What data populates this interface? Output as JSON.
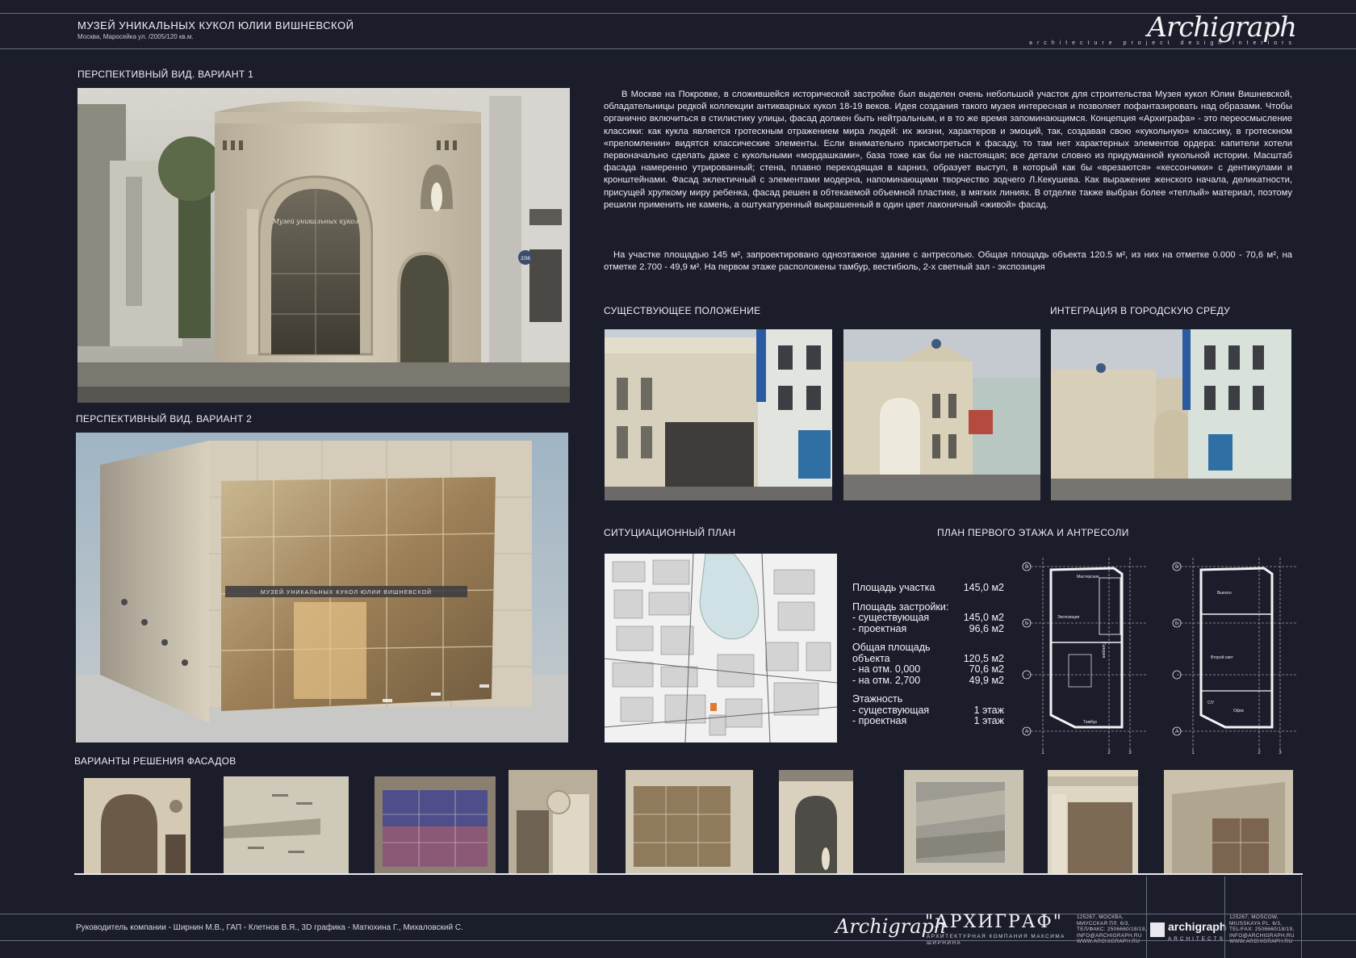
{
  "header": {
    "title": "МУЗЕЙ УНИКАЛЬНЫХ КУКОЛ ЮЛИИ ВИШНЕВСКОЙ",
    "subtitle": "Москва, Маросейка ул. /2005/120 кв.м.",
    "logo_script": "Archigraph",
    "logo_tagline": "architecture project design interiors"
  },
  "sections": {
    "perspective_1": "ПЕРСПЕКТИВНЫЙ ВИД. ВАРИАНТ 1",
    "perspective_2": "ПЕРСПЕКТИВНЫЙ ВИД. ВАРИАНТ 2",
    "existing": "СУЩЕСТВУЮЩЕЕ ПОЛОЖЕНИЕ",
    "integration": "ИНТЕГРАЦИЯ В ГОРОДСКУЮ СРЕДУ",
    "site_plan": "СИТУЦИАЦИОННЫЙ ПЛАН",
    "floor_plan": "ПЛАН ПЕРВОГО ЭТАЖА И АНТРЕСОЛИ",
    "facades": "ВАРИАНТЫ РЕШЕНИЯ ФАСАДОВ"
  },
  "description": {
    "paragraph_1": "В Москве на Покровке, в сложившейся исторической застройке был выделен очень небольшой участок для строительства Музея кукол Юлии Вишневской, обладательницы редкой коллекции антикварных кукол 18-19 веков. Идея создания такого музея интересная и позволяет пофантазировать над образами. Чтобы органично включиться в стилистику улицы, фасад должен быть нейтральным, и в то же время запоминающимся. Концепция «Архиграфа» - это переосмысление классики: как кукла является гротескным отражением мира людей: их жизни, характеров и эмоций, так, создавая свою «кукольную» классику, в гротескном «преломлении» видятся классические элементы. Если внимательно присмотреться к фасаду, то там нет характерных элементов ордера: капители хотели первоначально сделать даже с кукольными «мордашками», база тоже как бы не настоящая; все детали словно из придуманной кукольной истории. Масштаб фасада намеренно утрированный; стена, плавно переходящая в карниз, образует выступ, в который как бы «врезаются» «кессончики» с дентикулами и кронштейнами. Фасад эклектичный с элементами модерна, напоминающими творчество зодчего Л.Кекушева. Как выражение женского начала, деликатности, присущей хрупкому миру ребенка, фасад решен в обтекаемой объемной пластике, в мягких линиях. В отделке также выбран более «теплый» материал, поэтому решили применить не камень, а оштукатуренный выкрашенный в один цвет лаконичный «живой» фасад.",
    "paragraph_2": "На участке площадью 145 м², запроектировано одноэтажное здание с антресолью. Общая площадь объекта 120.5 м², из них на отметке 0.000 - 70,6 м², на отметке 2.700 - 49,9 м². На первом этаже расположены тамбур, вестибюль, 2-х светный зал - экспозиция"
  },
  "stats": {
    "plot_label": "Площадь участка",
    "plot_value": "145,0 м2",
    "built_label": "Площадь застройки:",
    "built_existing_label": "- существующая",
    "built_existing_value": "145,0 м2",
    "built_project_label": "- проектная",
    "built_project_value": "96,6 м2",
    "total_label_1": "Общая площадь",
    "total_label_2": "объекта",
    "total_value": "120,5 м2",
    "mark0_label": "- на отм. 0,000",
    "mark0_value": "70,6 м2",
    "mark27_label": "- на отм. 2,700",
    "mark27_value": "49,9 м2",
    "floors_label": "Этажность",
    "floors_existing_label": "- существующая",
    "floors_existing_value": "1 этаж",
    "floors_project_label": "- проектная",
    "floors_project_value": "1 этаж"
  },
  "images": {
    "variant1_sign": "Музей уникальных кукол",
    "variant2_sign": "МУЗЕЙ УНИКАЛЬНЫХ КУКОЛ ЮЛИИ ВИШНЕВСКОЙ",
    "street_number": "2/36"
  },
  "plan": {
    "left_rooms": [
      "Мастерская",
      "Экспозиция",
      "Галерея",
      "Тамбур"
    ],
    "right_rooms": [
      "Выносн",
      "Второй свет",
      "Офис",
      "С/У"
    ],
    "axes": [
      "В",
      "Б",
      "А",
      "1",
      "2",
      "3"
    ]
  },
  "footer": {
    "credits": "Руководитель компании - Ширнин М.В., ГАП - Клетнов В.Я., 3D графика - Матюхина Г., Михаловский С.",
    "brand_ru": "\"АРХИГРАФ\"",
    "brand_ru_sub": "АРХИТЕКТУРНАЯ КОМПАНИЯ МАКСИМА ШИРНИНА",
    "address_ru": [
      "125267, МОСКВА,",
      "МИУССКАЯ ПЛ. 6/3,",
      "ТЕЛ/ФАКС: 2506660/18/19,",
      "INFO@ARCHIGRAPH.RU",
      "WWW.ARCHIGRAPH.RU"
    ],
    "brand_en": "archigraph",
    "brand_en_sub": "ARCHITECTS",
    "address_en": [
      "125267, MOSCOW,",
      "MIUSSKAYA PL. 6/3,",
      "TEL/FAX: 2506660/18/19,",
      "INFO@ARCHIGRAPH.RU",
      "WWW.ARCHIGRAPH.RU"
    ]
  },
  "colors": {
    "background": "#1b1d2b",
    "text": "#e8e8ee",
    "stone": "#c9bda4"
  }
}
